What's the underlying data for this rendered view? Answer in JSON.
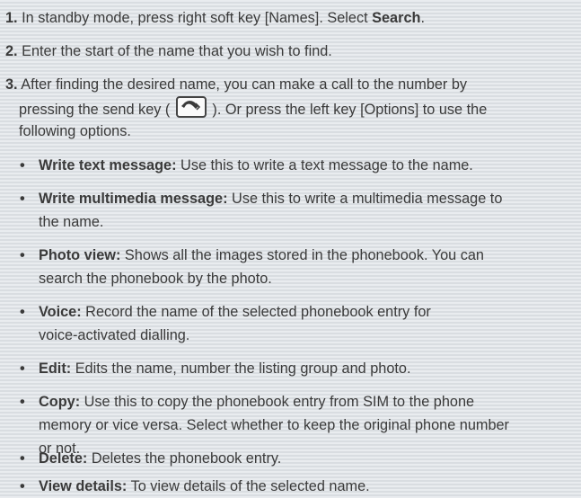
{
  "steps": [
    {
      "num": "1.",
      "before": " In standby mode, press right soft key [Names]. Select ",
      "bold": "Search",
      "after": "."
    },
    {
      "num": "2.",
      "text": " Enter the start of the name that you wish to find."
    },
    {
      "num": "3.",
      "line1_before": " After finding the desired name, you can make a call to the number by",
      "line2_before": "pressing the send key (",
      "line2_after": "). Or press the left key [Options] to use the",
      "line3": "following options."
    }
  ],
  "send_key_icon": "send-call-icon",
  "bullets": [
    {
      "term": "Write text message:",
      "lines": [
        " Use this to write a text message to the name."
      ]
    },
    {
      "term": "Write multimedia message:",
      "lines": [
        " Use this to write a multimedia message to",
        "the name."
      ]
    },
    {
      "term": "Photo view:",
      "lines": [
        " Shows all the images stored in the phonebook. You can",
        "search the phonebook by the photo."
      ]
    },
    {
      "term": "Voice:",
      "lines": [
        " Record the name of the selected phonebook entry for",
        "voice-activated dialling."
      ]
    },
    {
      "term": "Edit:",
      "lines": [
        " Edits the name, number the listing group and photo."
      ]
    },
    {
      "term": "Copy:",
      "lines": [
        " Use this to copy the phonebook entry from SIM to the phone",
        "memory or vice versa. Select whether to keep the original phone number",
        "or not."
      ]
    },
    {
      "term": "Delete:",
      "lines": [
        " Deletes the phonebook entry."
      ]
    },
    {
      "term": "View details:",
      "lines": [
        " To view details of the selected name."
      ]
    }
  ],
  "bullet_glyph": "•"
}
